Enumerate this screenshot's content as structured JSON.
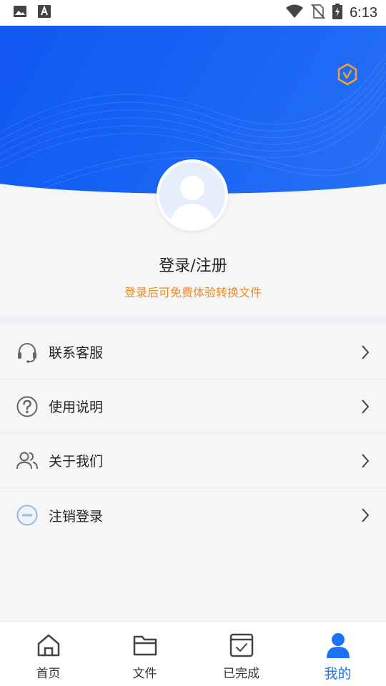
{
  "status_bar": {
    "time": "6:13",
    "icons": [
      "gallery-icon",
      "font-a-icon",
      "wifi-icon",
      "no-sim-icon",
      "battery-charging-icon"
    ]
  },
  "header": {
    "badge_icon": "verified-badge-icon",
    "colors": {
      "primary": "#1662f4",
      "badge": "#f0a32a"
    }
  },
  "profile": {
    "title": "登录/注册",
    "subtitle": "登录后可免费体验转换文件",
    "subtitle_color": "#f08b1b"
  },
  "menu": {
    "items": [
      {
        "label": "联系客服",
        "icon": "headset-icon"
      },
      {
        "label": "使用说明",
        "icon": "question-circle-icon"
      },
      {
        "label": "关于我们",
        "icon": "users-icon"
      },
      {
        "label": "注销登录",
        "icon": "minus-circle-icon"
      }
    ]
  },
  "bottom_nav": {
    "items": [
      {
        "label": "首页",
        "icon": "home-icon"
      },
      {
        "label": "文件",
        "icon": "folder-icon"
      },
      {
        "label": "已完成",
        "icon": "completed-icon"
      },
      {
        "label": "我的",
        "icon": "person-icon",
        "active": true
      }
    ],
    "active_color": "#1a73f5"
  }
}
